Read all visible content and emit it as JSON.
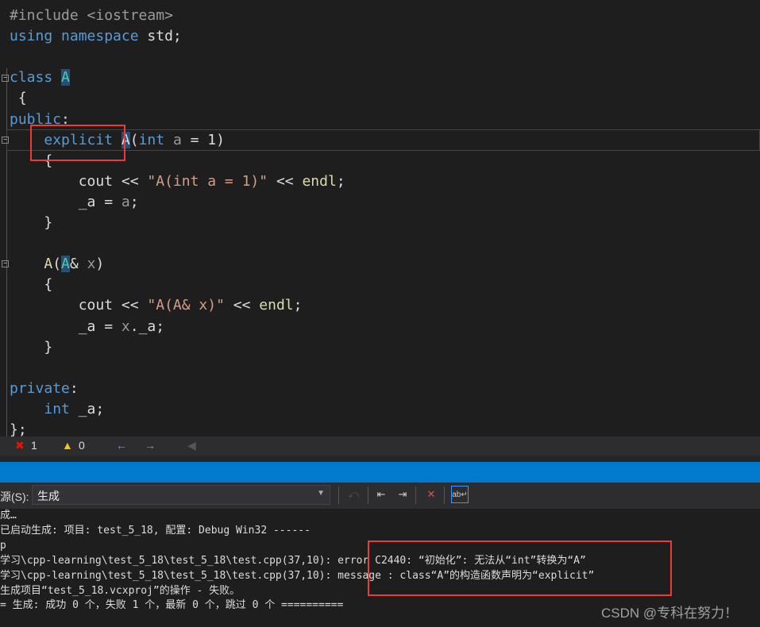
{
  "editor": {
    "lines": [
      [
        [
          "#include <iostream>",
          "pp"
        ]
      ],
      [
        [
          "using",
          "kw"
        ],
        [
          " "
        ],
        [
          "namespace",
          "kw"
        ],
        [
          " std;"
        ]
      ],
      [],
      [
        [
          "class",
          "kw"
        ],
        [
          " "
        ],
        [
          "A",
          "cls hl"
        ]
      ],
      [
        [
          " {"
        ]
      ],
      [
        [
          "public",
          "kw"
        ],
        [
          ":"
        ]
      ],
      [
        [
          "    "
        ],
        [
          "explicit",
          "kw"
        ],
        [
          " "
        ],
        [
          "A",
          "hl"
        ],
        [
          "("
        ],
        [
          "int",
          "kw"
        ],
        [
          " "
        ],
        [
          "a",
          "par"
        ],
        [
          " = 1)"
        ]
      ],
      [
        [
          "    {"
        ]
      ],
      [
        [
          "        cout << "
        ],
        [
          "\"A(int a = 1)\"",
          "str"
        ],
        [
          " << "
        ],
        [
          "endl",
          "fn"
        ],
        [
          ";"
        ]
      ],
      [
        [
          "        _a = "
        ],
        [
          "a",
          "par"
        ],
        [
          ";"
        ]
      ],
      [
        [
          "    }"
        ]
      ],
      [],
      [
        [
          "    "
        ],
        [
          "A",
          "fn"
        ],
        [
          "("
        ],
        [
          "A",
          "cls hl"
        ],
        [
          "& "
        ],
        [
          "x",
          "par"
        ],
        [
          ")"
        ]
      ],
      [
        [
          "    {"
        ]
      ],
      [
        [
          "        cout << "
        ],
        [
          "\"A(A& x)\"",
          "str"
        ],
        [
          " << "
        ],
        [
          "endl",
          "fn"
        ],
        [
          ";"
        ]
      ],
      [
        [
          "        _a = "
        ],
        [
          "x",
          "par"
        ],
        [
          "._a;"
        ]
      ],
      [
        [
          "    }"
        ]
      ],
      [],
      [
        [
          "private",
          "kw"
        ],
        [
          ":"
        ]
      ],
      [
        [
          "    "
        ],
        [
          "int",
          "kw"
        ],
        [
          " _a;"
        ]
      ],
      [
        [
          "};"
        ]
      ]
    ]
  },
  "status": {
    "errors": "1",
    "warnings": "0",
    "error_icon": "error-circle-icon",
    "warning_icon": "warning-triangle-icon"
  },
  "toolbar": {
    "source_label": "源(S):",
    "source_value": "生成"
  },
  "output": {
    "lines": [
      "成…",
      "已启动生成: 项目: test_5_18, 配置: Debug Win32 ------",
      "p",
      "学习\\cpp-learning\\test_5_18\\test_5_18\\test.cpp(37,10): error C2440: “初始化”: 无法从“int”转换为“A”",
      "学习\\cpp-learning\\test_5_18\\test_5_18\\test.cpp(37,10): message : class“A”的构造函数声明为“explicit”",
      "生成项目“test_5_18.vcxproj”的操作 - 失败。",
      "= 生成: 成功 0 个，失败 1 个，最新 0 个，跳过 0 个 =========="
    ]
  },
  "watermark": "CSDN @专科在努力！",
  "colors": {
    "accent": "#007acc",
    "highlight": "#f03a3a",
    "keyword": "#569cd6",
    "type": "#4ec9b0",
    "string": "#d69d85"
  }
}
